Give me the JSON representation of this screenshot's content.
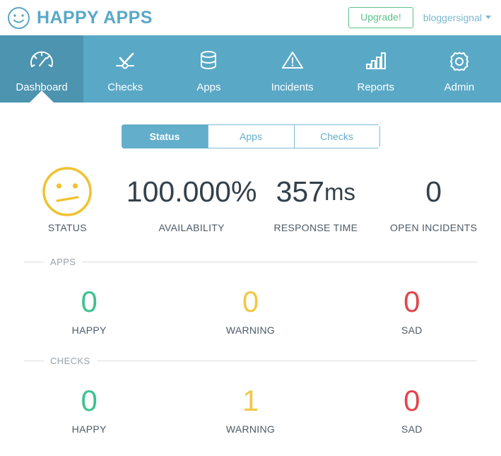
{
  "header": {
    "brand_name": "HAPPY APPS",
    "brand_icon": "smiley-face-icon",
    "brand_color": "#5aa8c8",
    "upgrade_label": "Upgrade!",
    "upgrade_color": "#5cc08a",
    "username": "bloggersignal"
  },
  "nav": {
    "items": [
      {
        "label": "Dashboard",
        "icon": "gauge-icon",
        "active": true
      },
      {
        "label": "Checks",
        "icon": "check-slider-icon",
        "active": false
      },
      {
        "label": "Apps",
        "icon": "database-icon",
        "active": false
      },
      {
        "label": "Incidents",
        "icon": "warning-triangle-icon",
        "active": false
      },
      {
        "label": "Reports",
        "icon": "bar-chart-icon",
        "active": false
      },
      {
        "label": "Admin",
        "icon": "gear-icon",
        "active": false
      }
    ],
    "bar_color": "#59a8c6",
    "active_color": "#4c94b0"
  },
  "tabs": [
    {
      "label": "Status",
      "active": true
    },
    {
      "label": "Apps",
      "active": false
    },
    {
      "label": "Checks",
      "active": false
    }
  ],
  "summary": {
    "status": {
      "label": "STATUS",
      "icon": "meh-face-icon",
      "state": "warning",
      "color": "#f0c22e"
    },
    "availability": {
      "value": "100.000%",
      "label": "AVAILABILITY"
    },
    "response_time": {
      "value": "357",
      "unit": "ms",
      "label": "RESPONSE TIME"
    },
    "open_incidents": {
      "value": "0",
      "label": "OPEN INCIDENTS"
    }
  },
  "sections": [
    {
      "title": "APPS",
      "stats": [
        {
          "value": "0",
          "label": "HAPPY",
          "color": "#3ec28f"
        },
        {
          "value": "0",
          "label": "WARNING",
          "color": "#f0c848"
        },
        {
          "value": "0",
          "label": "SAD",
          "color": "#e0474c"
        }
      ]
    },
    {
      "title": "CHECKS",
      "stats": [
        {
          "value": "0",
          "label": "HAPPY",
          "color": "#3ec28f"
        },
        {
          "value": "1",
          "label": "WARNING",
          "color": "#f0c848"
        },
        {
          "value": "0",
          "label": "SAD",
          "color": "#e0474c"
        }
      ]
    }
  ]
}
